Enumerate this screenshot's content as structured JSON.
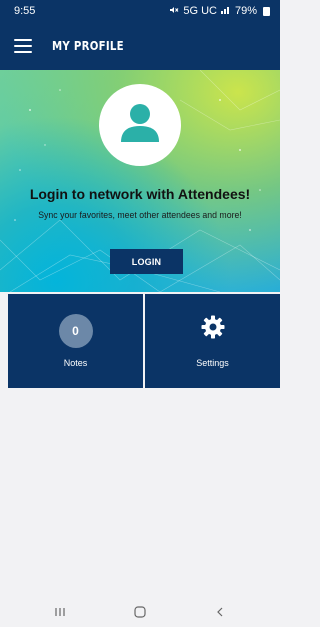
{
  "status_bar": {
    "time": "9:55",
    "network": "5G UC",
    "battery": "79%"
  },
  "app_bar": {
    "title": "MY PROFILE",
    "menu_icon": "hamburger-menu-icon"
  },
  "hero": {
    "avatar_icon": "person-icon",
    "heading": "Login to network with Attendees!",
    "subtitle": "Sync your favorites, meet other attendees and more!",
    "login_label": "LOGIN"
  },
  "tiles": [
    {
      "label": "Notes",
      "count": "0",
      "icon": "count-badge"
    },
    {
      "label": "Settings",
      "icon": "gear-icon"
    }
  ],
  "nav_bar": {
    "buttons": [
      "recent-apps-icon",
      "home-icon",
      "back-icon"
    ]
  },
  "colors": {
    "primary": "#0b3466",
    "avatar_teal": "#2bb0a8",
    "badge": "#6c88a8"
  }
}
